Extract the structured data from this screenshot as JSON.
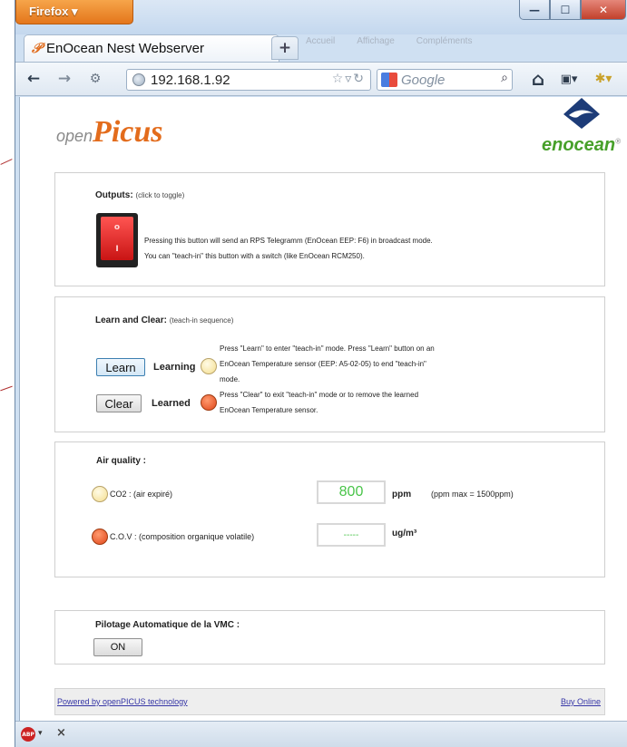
{
  "browser": {
    "menu_button": "Firefox ▾",
    "tab_title": "EnOcean Nest Webserver",
    "new_tab": "+",
    "ghost_tabs": [
      "Accueil",
      "Affichage",
      "Compléments"
    ],
    "url": "192.168.1.92",
    "search_placeholder": "Google",
    "window_controls": {
      "minimize": "—",
      "maximize": "☐",
      "close": "✕"
    },
    "nav_icons": {
      "back": "←",
      "forward": "→",
      "home": "⌂"
    },
    "statusbar_close": "×",
    "abp_label": "ABP"
  },
  "logos": {
    "open": "open",
    "picus": "Picus",
    "enocean": "enocean",
    "registered": "®"
  },
  "outputs": {
    "title": "Outputs:",
    "subtitle": "(click to toggle)",
    "line1": "Pressing this button will send an RPS Telegramm (EnOcean EEP: F6) in broadcast mode.",
    "line2": "You can \"teach-in\" this button with a switch (like EnOcean RCM250).",
    "rocker_top": "o",
    "rocker_bottom": "I"
  },
  "learn": {
    "title": "Learn and Clear:",
    "subtitle": "(teach-in sequence)",
    "learn_button": "Learn",
    "learning_label": "Learning",
    "learn_desc_1": "Press \"Learn\" to enter \"teach-in\" mode. Press \"Learn\" button on an",
    "learn_desc_2": "EnOcean Temperature sensor (EEP: A5-02-05) to end \"teach-in\"",
    "learn_desc_3": "mode.",
    "clear_button": "Clear",
    "learned_label": "Learned",
    "clear_desc_1": "Press \"Clear\" to exit \"teach-in\" mode or to remove the learned",
    "clear_desc_2": "EnOcean Temperature sensor."
  },
  "air": {
    "title": "Air quality :",
    "co2_label": "CO2 : (air expiré)",
    "co2_value": "800",
    "co2_unit": "ppm",
    "co2_max": "(ppm max = 1500ppm)",
    "cov_label": "C.O.V : (composition organique volatile)",
    "cov_value": "-----",
    "cov_unit": "ug/m³"
  },
  "vmc": {
    "title": "Pilotage Automatique de la VMC :",
    "button": "ON"
  },
  "footer": {
    "powered": "Powered by openPICUS technology",
    "buy": "Buy Online"
  },
  "colors": {
    "accent_orange": "#e36c1c",
    "enocean_green": "#47a02a",
    "value_green": "#49c449",
    "led_on": "#e0461a",
    "led_off": "#f4dd8d"
  }
}
